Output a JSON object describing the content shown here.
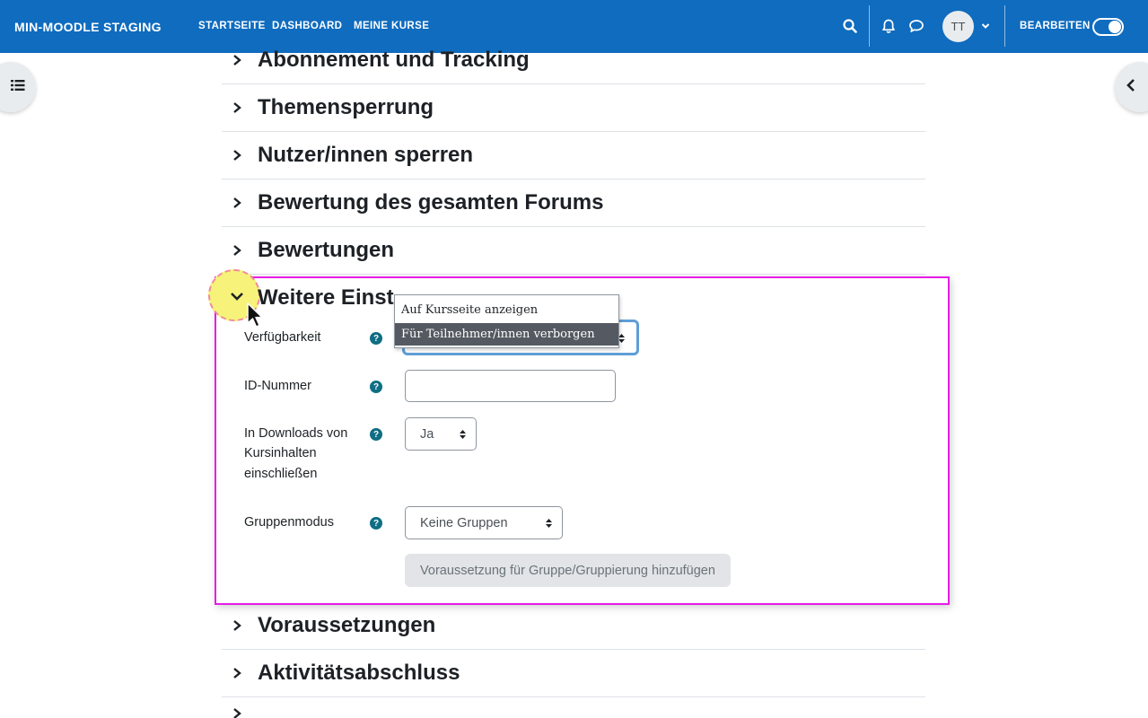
{
  "navbar": {
    "brand": "MIN-MOODLE STAGING",
    "links": [
      "STARTSEITE",
      "DASHBOARD",
      "MEINE KURSE"
    ],
    "avatar_initials": "TT",
    "edit_mode_label": "BEARBEITEN",
    "edit_mode_on": true,
    "icons": [
      "search-icon",
      "bell-icon",
      "chat-icon",
      "chevron-down-icon"
    ]
  },
  "sections_above": [
    {
      "title": "Abonnement und Tracking"
    },
    {
      "title": "Themensperrung"
    },
    {
      "title": "Nutzer/innen sperren"
    },
    {
      "title": "Bewertung des gesamten Forums"
    },
    {
      "title": "Bewertungen"
    }
  ],
  "expanded_section": {
    "title": "Weitere Einst",
    "fields": {
      "availability": {
        "label": "Verfügbarkeit",
        "options": [
          "Auf Kursseite anzeigen",
          "Für Teilnehmer/innen verborgen"
        ],
        "highlighted_option": "Für Teilnehmer/innen verborgen"
      },
      "idnumber": {
        "label": "ID-Nummer",
        "value": ""
      },
      "downloads": {
        "label_lines": [
          "In Downloads von",
          "Kursinhalten",
          "einschließen"
        ],
        "value": "Ja"
      },
      "groupmode": {
        "label": "Gruppenmodus",
        "value": "Keine Gruppen"
      },
      "add_restriction_button": "Voraussetzung für Gruppe/Gruppierung hinzufügen"
    }
  },
  "sections_below": [
    {
      "title": "Voraussetzungen"
    },
    {
      "title": "Aktivitätsabschluss"
    }
  ],
  "colors": {
    "navbar": "#0f6cbf",
    "highlight_border": "#e61de6",
    "help_icon": "#0f6e84",
    "focus_ring": "#5e9ed6"
  }
}
